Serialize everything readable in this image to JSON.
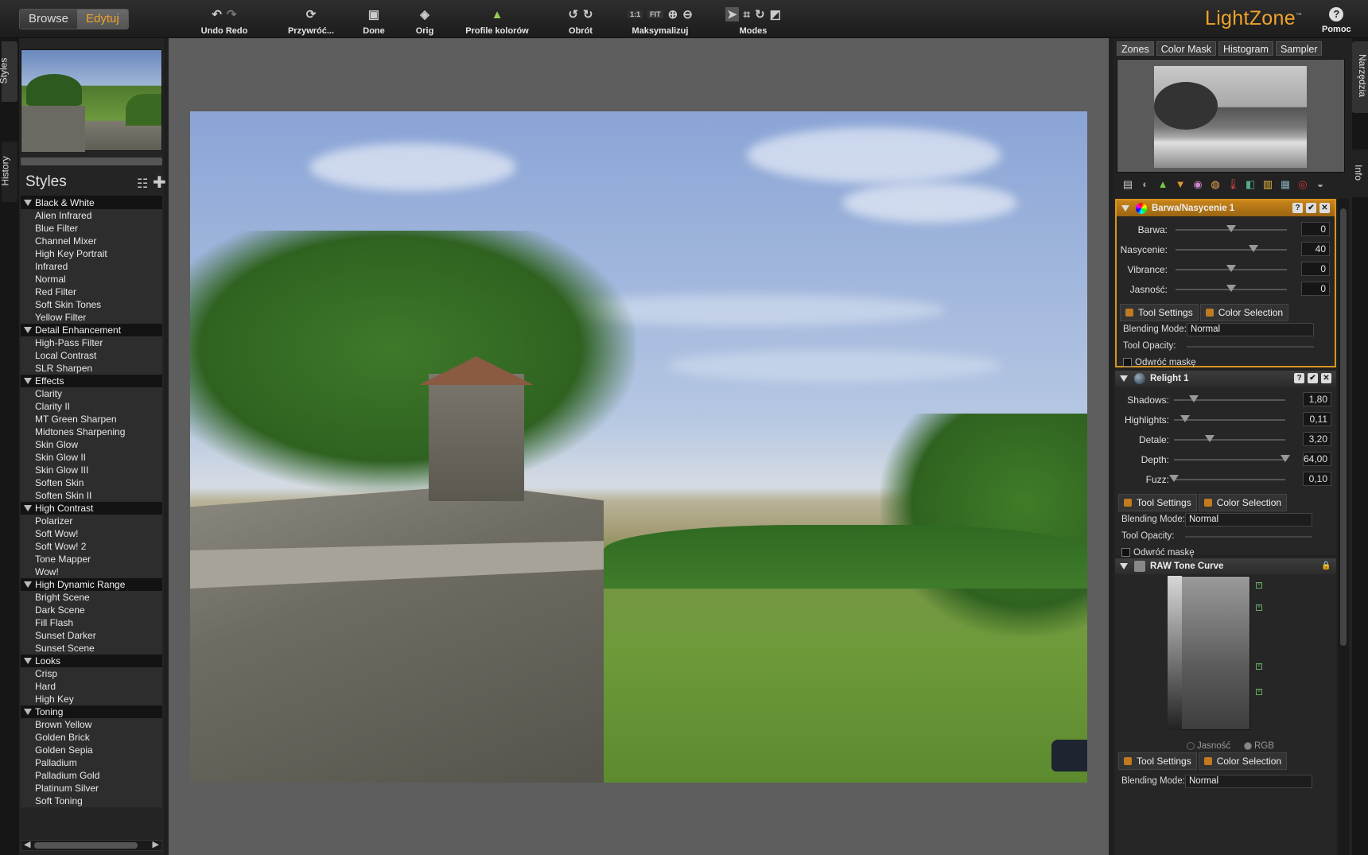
{
  "toolbar": {
    "mode_browse": "Browse",
    "mode_edit": "Edytuj",
    "undo_redo": "Undo Redo",
    "revert": "Przywróć...",
    "done": "Done",
    "orig": "Orig",
    "color_profiles": "Profile kolorów",
    "rotate": "Obrót",
    "zoom_1to1": "1:1",
    "zoom_fit": "FIT",
    "maximize": "Maksymalizuj",
    "modes": "Modes",
    "logo": "LightZone",
    "logo_tm": "™",
    "help_icon": "?",
    "help": "Pomoc"
  },
  "left_tabs": {
    "styles": "Styles",
    "history": "History"
  },
  "styles": {
    "title": "Styles",
    "categories": [
      {
        "name": "Black & White",
        "items": [
          "Alien Infrared",
          "Blue Filter",
          "Channel Mixer",
          "High Key Portrait",
          "Infrared",
          "Normal",
          "Red Filter",
          "Soft Skin Tones",
          "Yellow Filter"
        ]
      },
      {
        "name": "Detail Enhancement",
        "items": [
          "High-Pass Filter",
          "Local Contrast",
          "SLR Sharpen"
        ]
      },
      {
        "name": "Effects",
        "items": [
          "Clarity",
          "Clarity II",
          "MT Green Sharpen",
          "Midtones Sharpening",
          "Skin Glow",
          "Skin Glow II",
          "Skin Glow III",
          "Soften Skin",
          "Soften Skin II"
        ]
      },
      {
        "name": "High Contrast",
        "items": [
          "Polarizer",
          "Soft Wow!",
          "Soft Wow! 2",
          "Tone Mapper",
          "Wow!"
        ]
      },
      {
        "name": "High Dynamic Range",
        "items": [
          "Bright Scene",
          "Dark Scene",
          "Fill Flash",
          "Sunset Darker",
          "Sunset Scene"
        ]
      },
      {
        "name": "Looks",
        "items": [
          "Crisp",
          "Hard",
          "High Key"
        ]
      },
      {
        "name": "Toning",
        "items": [
          "Brown Yellow",
          "Golden Brick",
          "Golden Sepia",
          "Palladium",
          "Palladium Gold",
          "Platinum Silver",
          "Soft Toning"
        ]
      }
    ]
  },
  "right_tabs": {
    "tools": "Narzędzia",
    "info": "Info"
  },
  "info_tabs": [
    "Zones",
    "Color Mask",
    "Histogram",
    "Sampler"
  ],
  "tools": {
    "hue_sat": {
      "title": "Barwa/Nasycenie 1",
      "sliders": [
        {
          "label": "Barwa:",
          "value": "0",
          "pos": 0.5
        },
        {
          "label": "Nasycenie:",
          "value": "40",
          "pos": 0.7
        },
        {
          "label": "Vibrance:",
          "value": "0",
          "pos": 0.5
        },
        {
          "label": "Jasność:",
          "value": "0",
          "pos": 0.5
        }
      ],
      "tab_settings": "Tool Settings",
      "tab_color": "Color Selection",
      "blend_label": "Blending Mode:",
      "blend_value": "Normal",
      "opacity_label": "Tool Opacity:",
      "invert_label": "Odwróć maskę"
    },
    "relight": {
      "title": "Relight 1",
      "sliders": [
        {
          "label": "Shadows:",
          "value": "1,80",
          "pos": 0.18
        },
        {
          "label": "Highlights:",
          "value": "0,11",
          "pos": 0.1
        },
        {
          "label": "Detale:",
          "value": "3,20",
          "pos": 0.32
        },
        {
          "label": "Depth:",
          "value": "64,00",
          "pos": 1.0
        },
        {
          "label": "Fuzz:",
          "value": "0,10",
          "pos": 0.0
        }
      ],
      "tab_settings": "Tool Settings",
      "tab_color": "Color Selection",
      "blend_label": "Blending Mode:",
      "blend_value": "Normal",
      "opacity_label": "Tool Opacity:",
      "invert_label": "Odwróć maskę"
    },
    "tone_curve": {
      "title": "RAW Tone Curve",
      "radio_lum": "Jasność",
      "radio_rgb": "RGB",
      "tab_settings": "Tool Settings",
      "tab_color": "Color Selection",
      "blend_label": "Blending Mode:",
      "blend_value": "Normal"
    }
  }
}
